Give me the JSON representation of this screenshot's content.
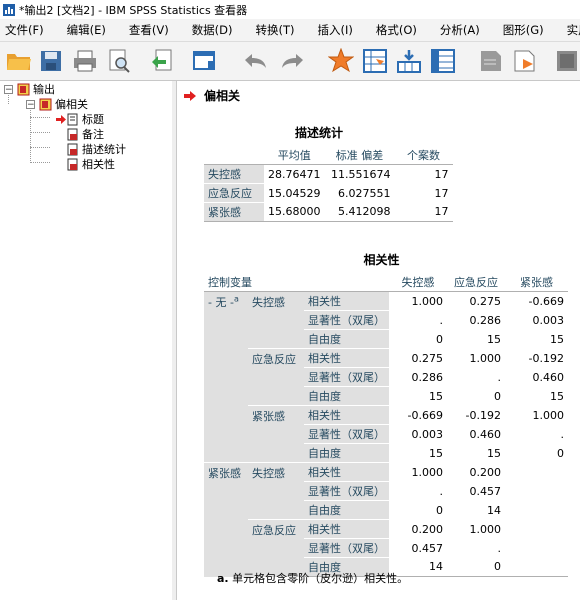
{
  "window": {
    "title": "*输出2 [文档2] - IBM SPSS Statistics 查看器"
  },
  "menu": [
    "文件(F)",
    "编辑(E)",
    "查看(V)",
    "数据(D)",
    "转换(T)",
    "插入(I)",
    "格式(O)",
    "分析(A)",
    "图形(G)",
    "实用程序(U)"
  ],
  "toolbar": {
    "icons": [
      "open-folder-icon",
      "save-icon",
      "print-icon",
      "print-preview-icon",
      "export-icon",
      "recall-dialog-icon",
      "undo-icon",
      "redo-icon",
      "goto-data-icon",
      "goto-case-icon",
      "goto-variable-icon",
      "variables-icon",
      "designate-window-icon",
      "script-icon",
      "run-icon"
    ]
  },
  "outline": {
    "root": "输出",
    "procedure": "偏相关",
    "items": [
      "标题",
      "备注",
      "描述统计",
      "相关性"
    ]
  },
  "content": {
    "section_title": "偏相关",
    "desc": {
      "title": "描述统计",
      "headers": [
        "平均值",
        "标准 偏差",
        "个案数"
      ],
      "rows": [
        {
          "label": "失控感",
          "mean": "28.76471",
          "sd": "11.551674",
          "n": "17"
        },
        {
          "label": "应急反应",
          "mean": "15.04529",
          "sd": "6.027551",
          "n": "17"
        },
        {
          "label": "紧张感",
          "mean": "15.68000",
          "sd": "5.412098",
          "n": "17"
        }
      ]
    },
    "corr": {
      "title": "相关性",
      "control_header": "控制变量",
      "col_headers": [
        "失控感",
        "应急反应",
        "紧张感"
      ],
      "stat_labels": [
        "相关性",
        "显著性（双尾）",
        "自由度"
      ],
      "group1": {
        "label": "- 无 -",
        "superscript": "a",
        "vars": [
          {
            "name": "失控感",
            "values": [
              [
                "1.000",
                "0.275",
                "-0.669"
              ],
              [
                ".",
                "0.286",
                "0.003"
              ],
              [
                "0",
                "15",
                "15"
              ]
            ]
          },
          {
            "name": "应急反应",
            "values": [
              [
                "0.275",
                "1.000",
                "-0.192"
              ],
              [
                "0.286",
                ".",
                "0.460"
              ],
              [
                "15",
                "0",
                "15"
              ]
            ]
          },
          {
            "name": "紧张感",
            "values": [
              [
                "-0.669",
                "-0.192",
                "1.000"
              ],
              [
                "0.003",
                "0.460",
                "."
              ],
              [
                "15",
                "15",
                "0"
              ]
            ]
          }
        ]
      },
      "group2": {
        "label": "紧张感",
        "vars": [
          {
            "name": "失控感",
            "values": [
              [
                "1.000",
                "0.200"
              ],
              [
                ".",
                "0.457"
              ],
              [
                "0",
                "14"
              ]
            ]
          },
          {
            "name": "应急反应",
            "values": [
              [
                "0.200",
                "1.000"
              ],
              [
                "0.457",
                "."
              ],
              [
                "14",
                "0"
              ]
            ]
          }
        ]
      },
      "footnote_marker": "a.",
      "footnote_text": "单元格包含零阶（皮尔逊）相关性。"
    }
  }
}
